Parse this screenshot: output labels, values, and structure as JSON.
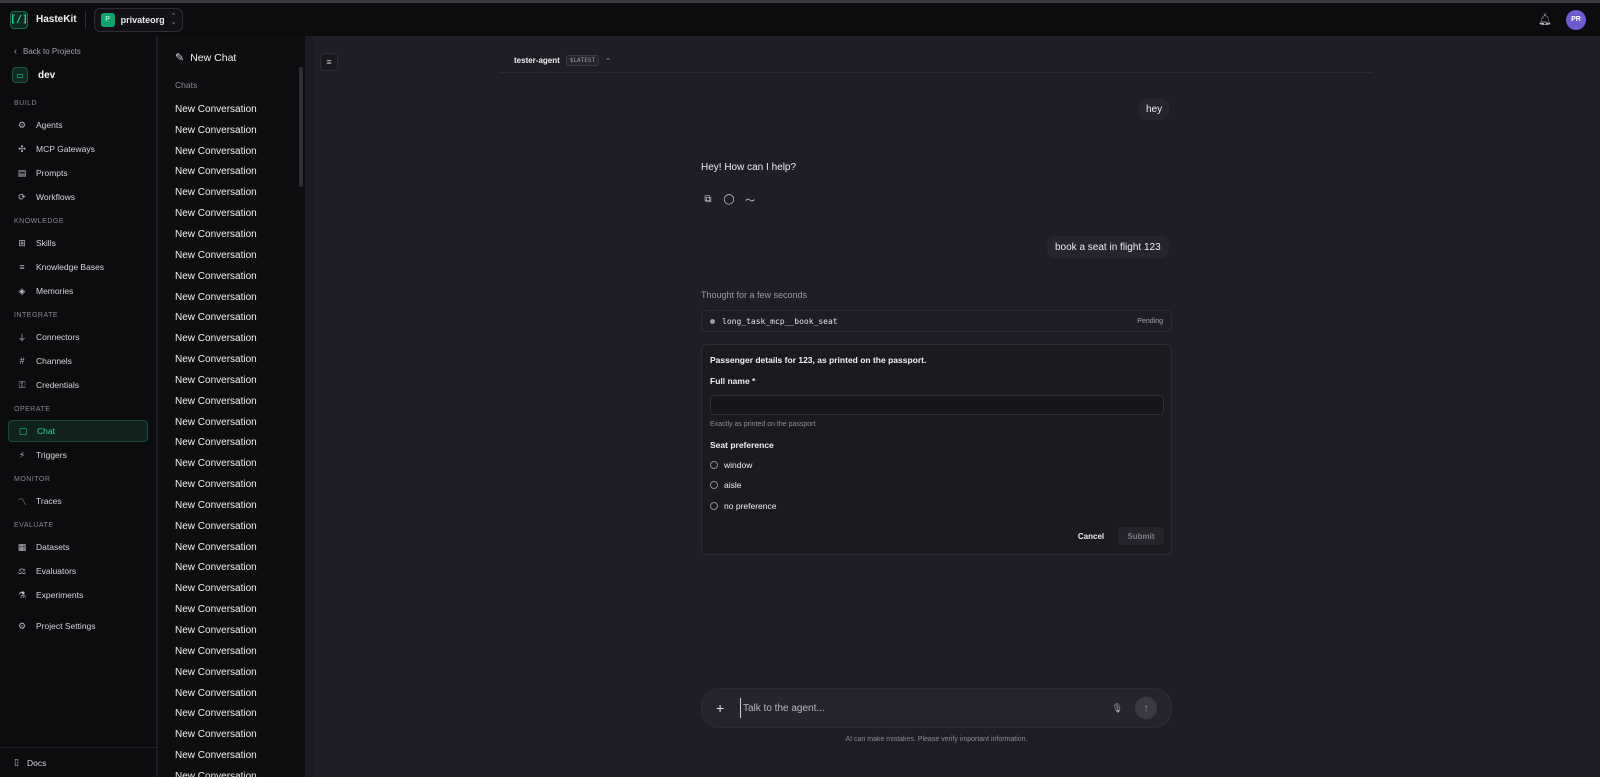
{
  "app": {
    "name": "HasteKit",
    "org_badge": "P",
    "org_name": "privateorg",
    "avatar_initials": "PR"
  },
  "sidebar": {
    "back_label": "Back to Projects",
    "project_name": "dev",
    "sections": {
      "build": "BUILD",
      "knowledge": "KNOWLEDGE",
      "integrate": "INTEGRATE",
      "operate": "OPERATE",
      "monitor": "MONITOR",
      "evaluate": "EVALUATE"
    },
    "items": {
      "agents": "Agents",
      "mcp_gateways": "MCP Gateways",
      "prompts": "Prompts",
      "workflows": "Workflows",
      "skills": "Skills",
      "knowledge_bases": "Knowledge Bases",
      "memories": "Memories",
      "connectors": "Connectors",
      "channels": "Channels",
      "credentials": "Credentials",
      "chat": "Chat",
      "triggers": "Triggers",
      "traces": "Traces",
      "datasets": "Datasets",
      "evaluators": "Evaluators",
      "experiments": "Experiments",
      "project_settings": "Project Settings"
    },
    "docs": "Docs",
    "active_item": "Chat"
  },
  "chats": {
    "new_chat": "New Chat",
    "label": "Chats",
    "items": [
      "New Conversation",
      "New Conversation",
      "New Conversation",
      "New Conversation",
      "New Conversation",
      "New Conversation",
      "New Conversation",
      "New Conversation",
      "New Conversation",
      "New Conversation",
      "New Conversation",
      "New Conversation",
      "New Conversation",
      "New Conversation",
      "New Conversation",
      "New Conversation",
      "New Conversation",
      "New Conversation",
      "New Conversation",
      "New Conversation",
      "New Conversation",
      "New Conversation",
      "New Conversation",
      "New Conversation",
      "New Conversation",
      "New Conversation",
      "New Conversation",
      "New Conversation",
      "New Conversation",
      "New Conversation",
      "New Conversation",
      "New Conversation",
      "New Conversation"
    ]
  },
  "conversation": {
    "agent_name": "tester-agent",
    "agent_version": "$LATEST",
    "user_message_1": "hey",
    "assistant_message_1": "Hey! How can I help?",
    "user_message_2": "book a seat in flight 123",
    "thought_label": "Thought for a few seconds",
    "tool_call": {
      "name": "long_task_mcp__book_seat",
      "status": "Pending"
    },
    "form": {
      "title": "Passenger details for 123, as printed on the passport.",
      "full_name_label": "Full name *",
      "full_name_value": "",
      "full_name_help": "Exactly as printed on the passport",
      "seat_label": "Seat preference",
      "seat_options": [
        "window",
        "aisle",
        "no preference"
      ],
      "cancel_label": "Cancel",
      "submit_label": "Submit"
    }
  },
  "composer": {
    "placeholder": "Talk to the agent...",
    "disclaimer": "AI can make mistakes. Please verify important information."
  },
  "colors": {
    "accent": "#34d399",
    "avatar": "#6d5bd0"
  },
  "icons": [
    "logo-icon",
    "chevron-updown-icon",
    "bell-icon",
    "arrow-left-icon",
    "folder-icon",
    "robot-icon",
    "network-icon",
    "file-icon",
    "workflow-icon",
    "grid-icon",
    "layers-icon",
    "brain-icon",
    "plug-icon",
    "hash-icon",
    "key-icon",
    "chat-icon",
    "bolt-icon",
    "trend-icon",
    "table-icon",
    "gavel-icon",
    "flask-icon",
    "gear-icon",
    "book-icon",
    "edit-icon",
    "sidebar-toggle-icon",
    "copy-icon",
    "regenerate-icon",
    "trace-icon",
    "plus-icon",
    "mic-icon",
    "send-icon"
  ]
}
